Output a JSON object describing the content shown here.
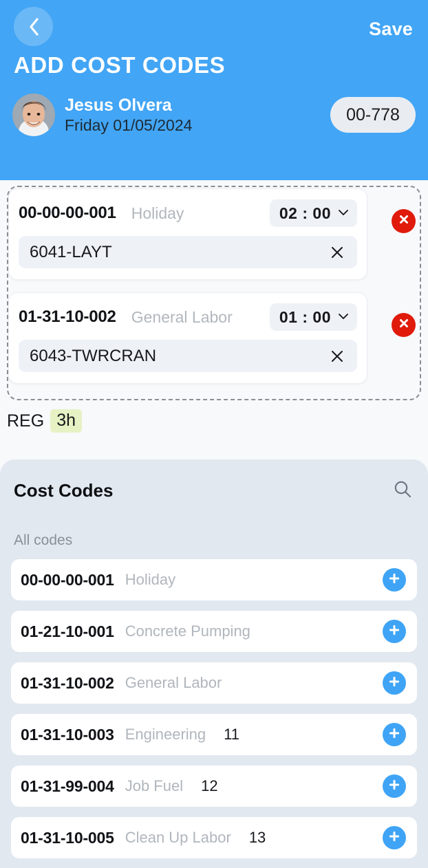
{
  "header": {
    "back_icon": "chevron-left-icon",
    "save_label": "Save",
    "title": "ADD COST CODES",
    "user_name": "Jesus Olvera",
    "date": "Friday 01/05/2024",
    "job_badge": "00-778",
    "background_color": "#42a5f5"
  },
  "entries": [
    {
      "code": "00-00-00-001",
      "description": "Holiday",
      "time": "02 : 00",
      "sub_code": "6041-LAYT",
      "delete_icon": "close-circle-icon",
      "clear_icon": "close-icon",
      "dropdown_icon": "chevron-down-icon"
    },
    {
      "code": "01-31-10-002",
      "description": "General Labor",
      "time": "01 : 00",
      "sub_code": "6043-TWRCRAN",
      "delete_icon": "close-circle-icon",
      "clear_icon": "close-icon",
      "dropdown_icon": "chevron-down-icon"
    }
  ],
  "totals": {
    "label": "REG",
    "hours": "3h",
    "hours_badge_color": "#e6f2c4"
  },
  "panel": {
    "title": "Cost Codes",
    "search_icon": "search-icon",
    "subtitle": "All codes",
    "background_color": "#e2e8f0",
    "rows": [
      {
        "code": "00-00-00-001",
        "description": "Holiday",
        "number": "",
        "add_icon": "plus-circle-icon"
      },
      {
        "code": "01-21-10-001",
        "description": "Concrete Pumping",
        "number": "",
        "add_icon": "plus-circle-icon"
      },
      {
        "code": "01-31-10-002",
        "description": "General Labor",
        "number": "",
        "add_icon": "plus-circle-icon"
      },
      {
        "code": "01-31-10-003",
        "description": "Engineering",
        "number": "11",
        "add_icon": "plus-circle-icon"
      },
      {
        "code": "01-31-99-004",
        "description": "Job Fuel",
        "number": "12",
        "add_icon": "plus-circle-icon"
      },
      {
        "code": "01-31-10-005",
        "description": "Clean Up Labor",
        "number": "13",
        "add_icon": "plus-circle-icon"
      }
    ]
  }
}
